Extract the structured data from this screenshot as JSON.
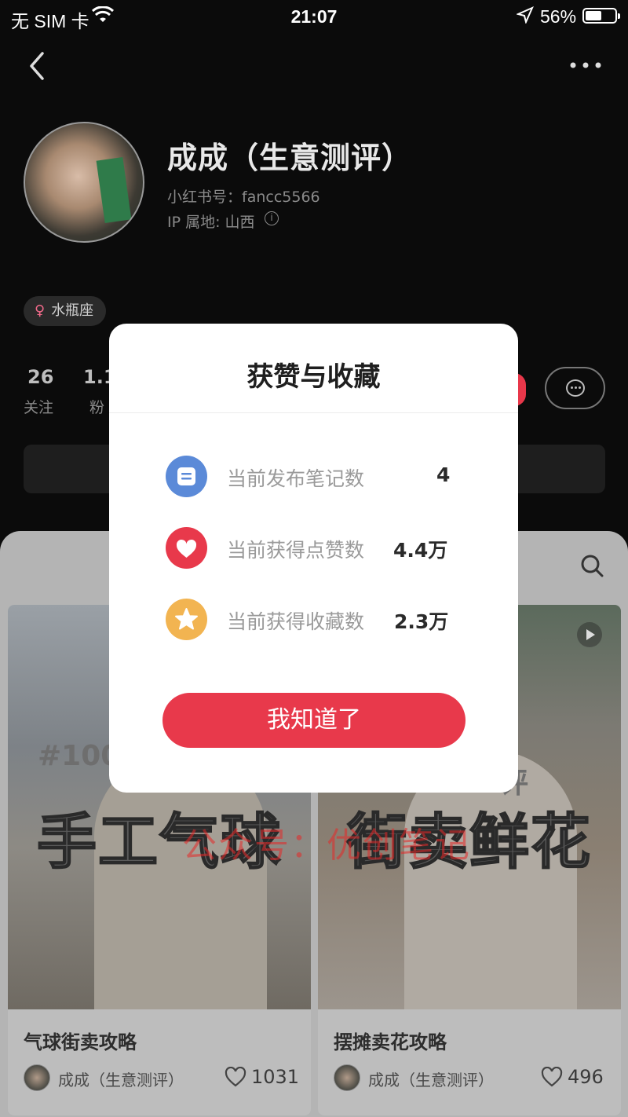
{
  "status_bar": {
    "carrier": "无 SIM 卡",
    "time": "21:07",
    "battery": "56%",
    "battery_level": 0.56
  },
  "nav": {
    "back_icon": "chevron-left-icon",
    "more_icon": "more-dots-icon"
  },
  "profile": {
    "name": "成成（生意测评）",
    "account_id": "小红书号：fancc5566",
    "ip_location": "IP 属地: 山西",
    "tag": "水瓶座",
    "tag_icon": "female-symbol-icon"
  },
  "stats": [
    {
      "value": "26",
      "label": "关注"
    },
    {
      "value": "1.1",
      "label": "粉"
    }
  ],
  "feed": {
    "cards": [
      {
        "cover_text": "手工气球",
        "cover_badge": "#100",
        "title": "气球街卖攻略",
        "author": "成成（生意测评）",
        "likes": "1031"
      },
      {
        "cover_text": "街卖鲜花",
        "cover_badge": "评",
        "title": "摆摊卖花攻略",
        "author": "成成（生意测评）",
        "likes": "496"
      }
    ]
  },
  "watermark": "公众号：优创笔记",
  "modal": {
    "title": "获赞与收藏",
    "rows": [
      {
        "icon": "note-icon",
        "label": "当前发布笔记数",
        "value": "4",
        "color": "#5b8ad8"
      },
      {
        "icon": "heart-icon",
        "label": "当前获得点赞数",
        "value": "4.4万",
        "color": "#e8394b"
      },
      {
        "icon": "star-icon",
        "label": "当前获得收藏数",
        "value": "2.3万",
        "color": "#f2b451"
      }
    ],
    "button": "我知道了"
  },
  "colors": {
    "accent": "#e8394b",
    "background": "#0b0b0b",
    "modal_bg": "#ffffff"
  }
}
